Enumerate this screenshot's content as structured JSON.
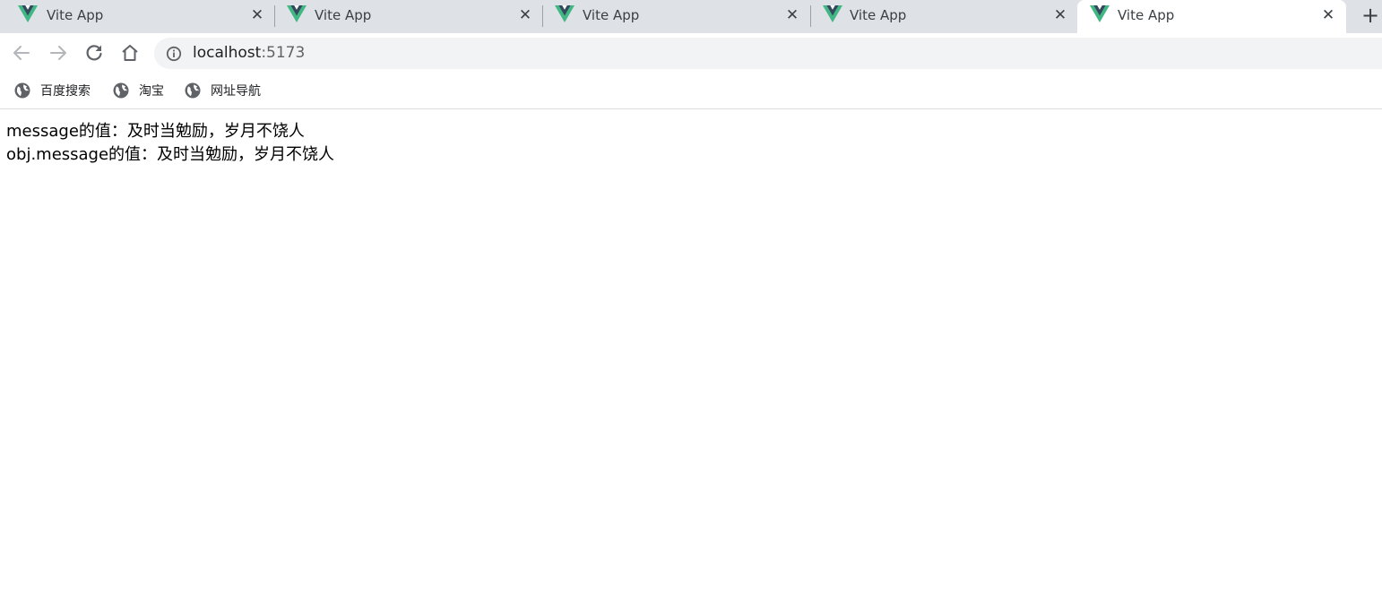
{
  "browser": {
    "tabs": [
      {
        "title": "Vite App",
        "active": false
      },
      {
        "title": "Vite App",
        "active": false
      },
      {
        "title": "Vite App",
        "active": false
      },
      {
        "title": "Vite App",
        "active": false
      },
      {
        "title": "Vite App",
        "active": true
      }
    ],
    "icons": {
      "tab_favicon": "vue-logo-icon",
      "tab_close": "close-icon",
      "new_tab": "plus-icon",
      "back": "arrow-left-icon",
      "forward": "arrow-right-icon",
      "reload": "reload-icon",
      "home": "home-icon",
      "site_info": "info-icon",
      "bookmark": "globe-icon"
    },
    "colors": {
      "tabstrip": "#dee1e6",
      "vue_green": "#41b883",
      "vue_dark": "#35495e",
      "omnibox": "#f1f3f4"
    },
    "address_bar": {
      "host": "localhost",
      "port": ":5173"
    },
    "bookmarks": [
      {
        "label": "百度搜索"
      },
      {
        "label": "淘宝"
      },
      {
        "label": "网址导航"
      }
    ]
  },
  "page": {
    "lines": [
      "message的值：及时当勉励，岁月不饶人",
      "obj.message的值：及时当勉励，岁月不饶人"
    ]
  }
}
